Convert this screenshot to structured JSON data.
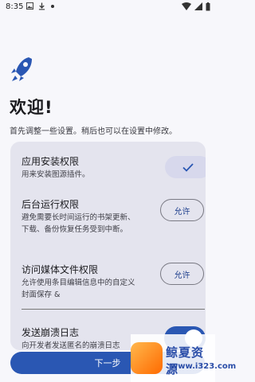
{
  "status_bar": {
    "time": "8:35"
  },
  "welcome": {
    "title": "欢迎!",
    "subtitle": "首先调整一些设置。稍后也可以在设置中修改。"
  },
  "permissions": [
    {
      "title": "应用安装权限",
      "desc": "用来安装图源插件。",
      "state": "granted"
    },
    {
      "title": "后台运行权限",
      "desc": "避免需要长时间运行的书架更新、下载、备份恢复任务受到中断。",
      "button": "允许"
    },
    {
      "title": "访问媒体文件权限",
      "desc": "允许使用条目编辑信息中的自定义封面保存 &",
      "button": "允许"
    }
  ],
  "crash_log": {
    "title": "发送崩溃日志",
    "desc_partial": "向开发者发送匿名的崩溃日志",
    "enabled": true
  },
  "footer": {
    "next_label": "下一步"
  },
  "watermark": {
    "title": "鲸夏资源",
    "url": "www.i323.com"
  },
  "colors": {
    "accent": "#2a57b3",
    "card": "#e4e4ee",
    "background": "#f7f7fb"
  }
}
